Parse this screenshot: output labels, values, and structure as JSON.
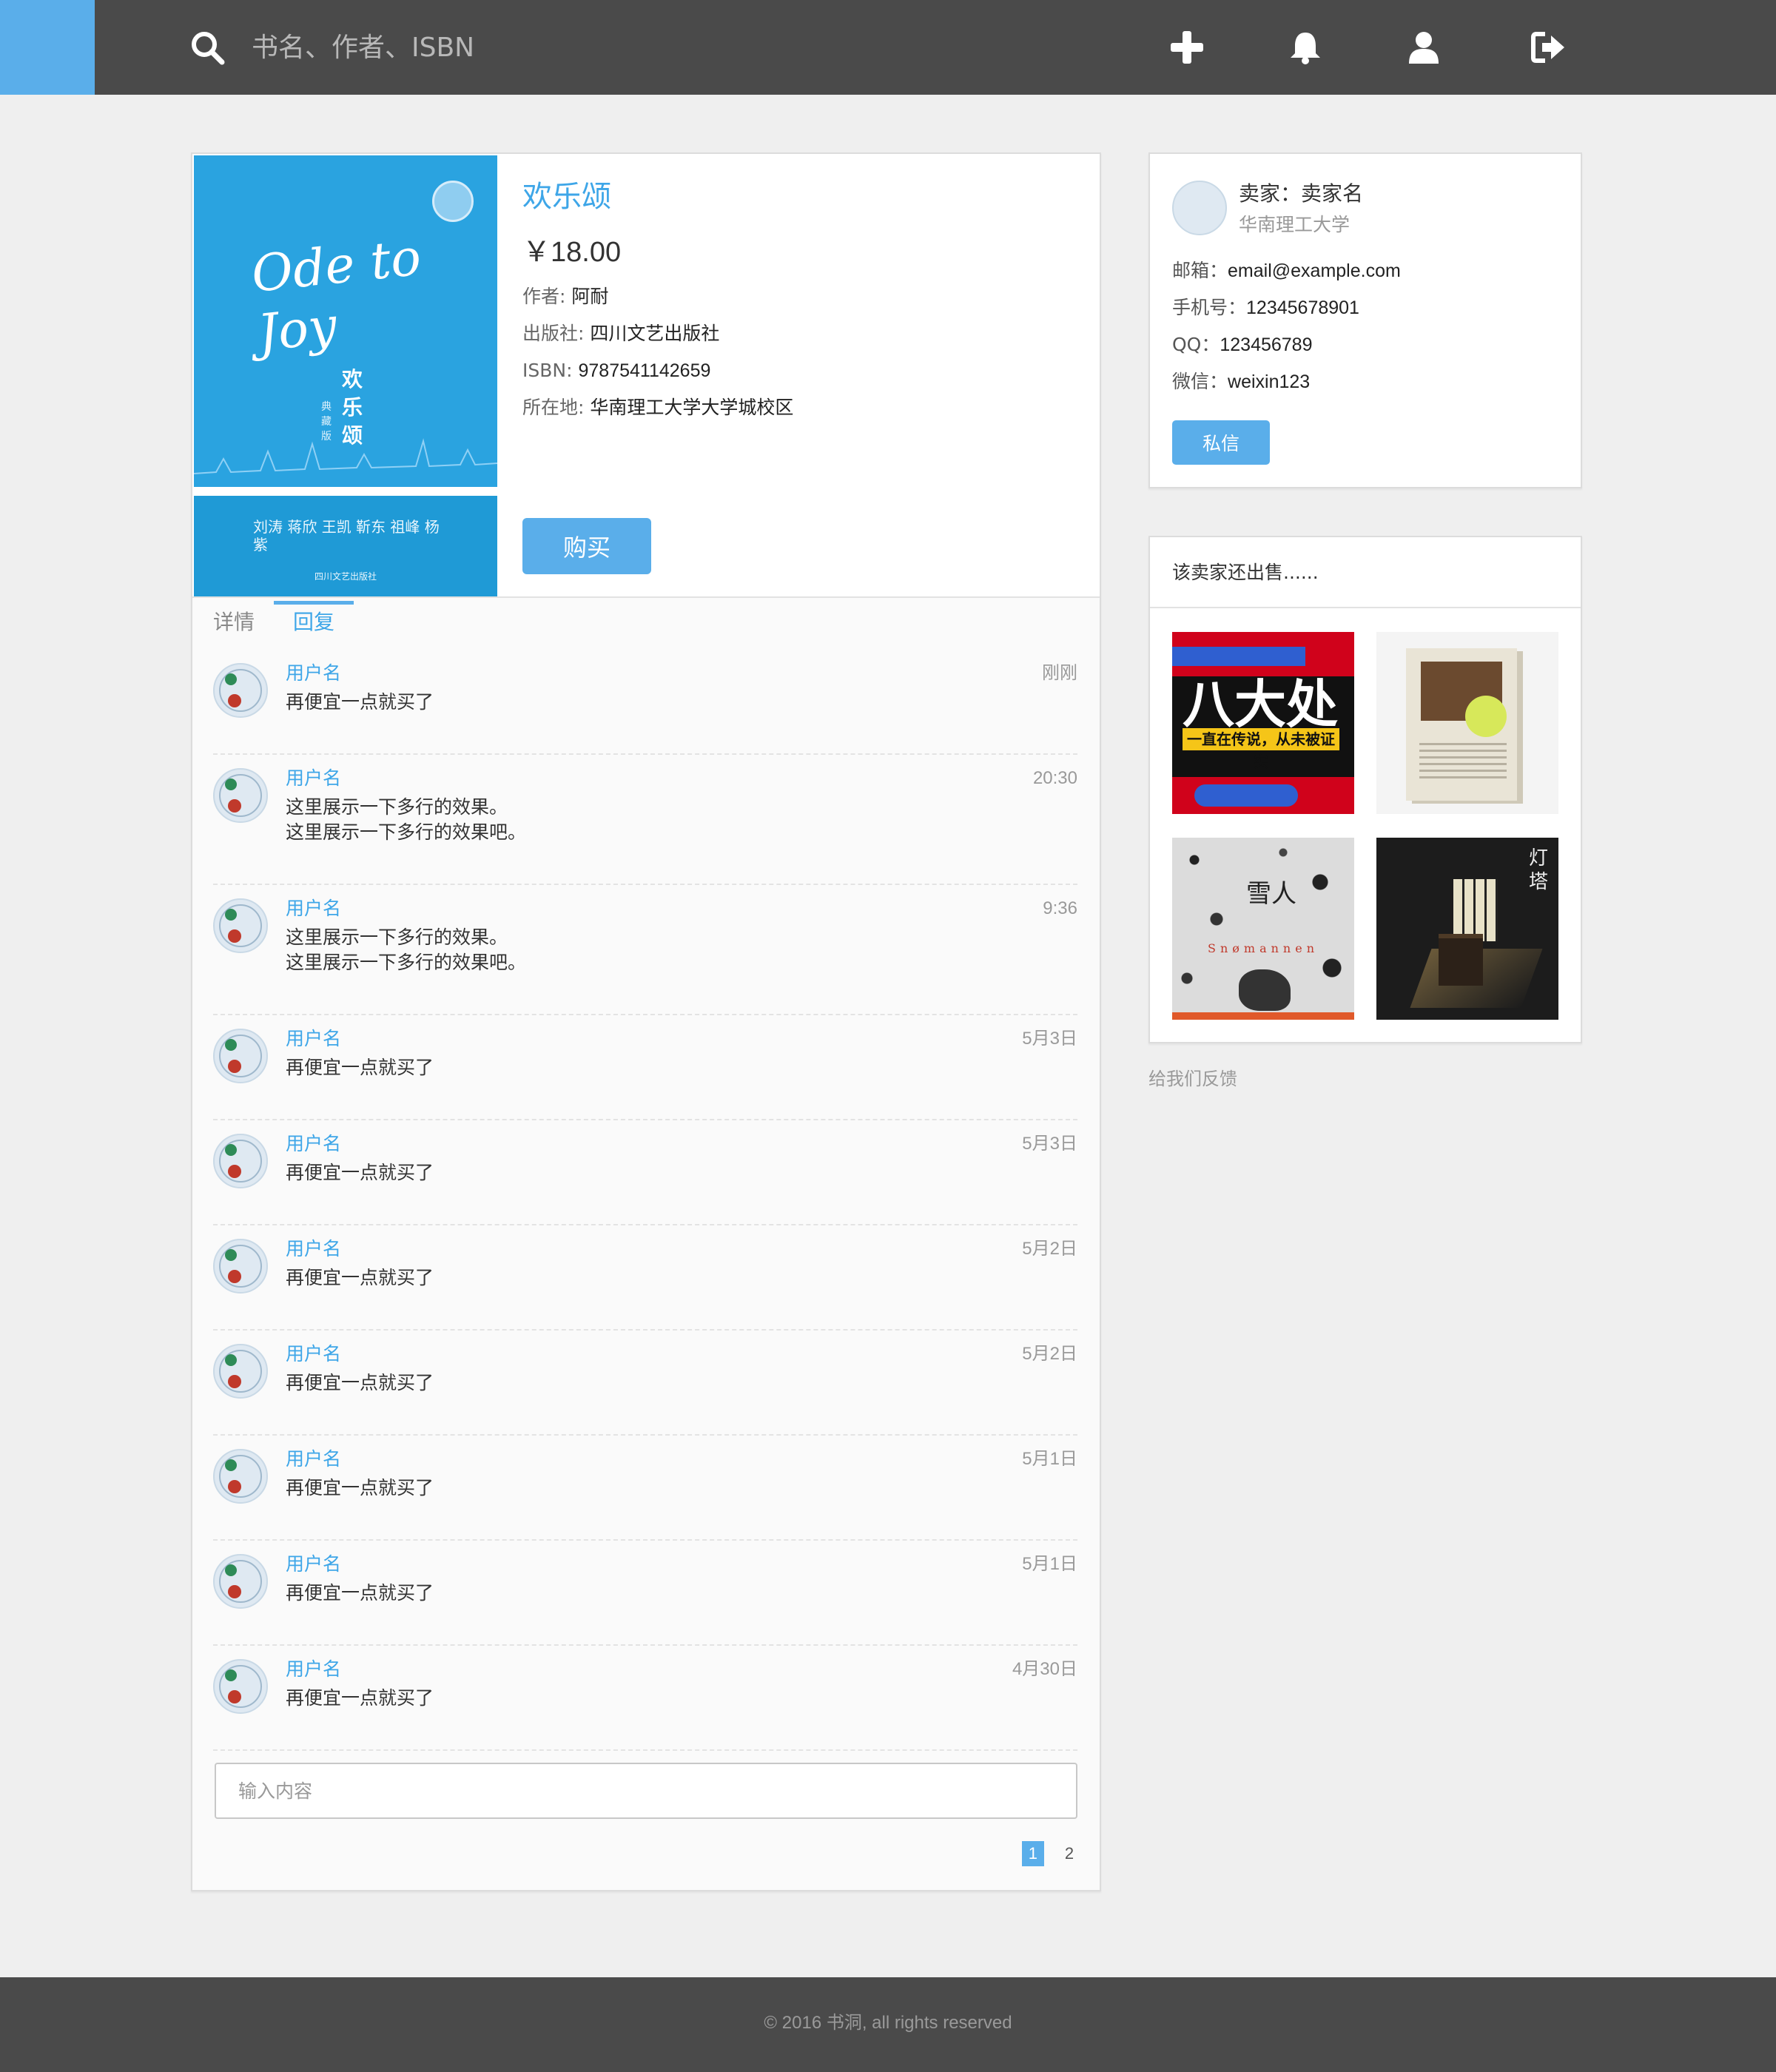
{
  "header": {
    "search_placeholder": "书名、作者、ISBN",
    "icons": [
      "search-icon",
      "plus-icon",
      "bell-icon",
      "user-icon",
      "logout-icon"
    ]
  },
  "book": {
    "title": "欢乐颂",
    "price": "￥18.00",
    "author_label": "作者:",
    "author": "阿耐",
    "publisher_label": "出版社:",
    "publisher": "四川文艺出版社",
    "isbn_label": "ISBN:",
    "isbn": "9787541142659",
    "location_label": "所在地:",
    "location": "华南理工大学大学城校区",
    "buy_label": "购买",
    "cover": {
      "ode_line1": "Ode to",
      "ode_line2": "Joy",
      "cn_title": "欢乐颂",
      "cn_sub": "典藏版",
      "names": "刘涛 蒋欣 王凯 靳东 祖峰 杨紫",
      "publisher_line": "四川文艺出版社"
    }
  },
  "tabs": {
    "detail": "详情",
    "reply": "回复",
    "active": "reply"
  },
  "comments": [
    {
      "user": "用户名",
      "time": "刚刚",
      "lines": [
        "再便宜一点就买了"
      ]
    },
    {
      "user": "用户名",
      "time": "20:30",
      "lines": [
        "这里展示一下多行的效果。",
        "这里展示一下多行的效果吧。"
      ]
    },
    {
      "user": "用户名",
      "time": "9:36",
      "lines": [
        "这里展示一下多行的效果。",
        "这里展示一下多行的效果吧。"
      ]
    },
    {
      "user": "用户名",
      "time": "5月3日",
      "lines": [
        "再便宜一点就买了"
      ]
    },
    {
      "user": "用户名",
      "time": "5月3日",
      "lines": [
        "再便宜一点就买了"
      ]
    },
    {
      "user": "用户名",
      "time": "5月2日",
      "lines": [
        "再便宜一点就买了"
      ]
    },
    {
      "user": "用户名",
      "time": "5月2日",
      "lines": [
        "再便宜一点就买了"
      ]
    },
    {
      "user": "用户名",
      "time": "5月1日",
      "lines": [
        "再便宜一点就买了"
      ]
    },
    {
      "user": "用户名",
      "time": "5月1日",
      "lines": [
        "再便宜一点就买了"
      ]
    },
    {
      "user": "用户名",
      "time": "4月30日",
      "lines": [
        "再便宜一点就买了"
      ]
    }
  ],
  "reply_input": {
    "placeholder": "输入内容",
    "value": ""
  },
  "pagination": {
    "pages": [
      "1",
      "2"
    ],
    "current": "1"
  },
  "seller": {
    "name": "卖家：卖家名",
    "school": "华南理工大学",
    "email_label": "邮箱：",
    "email": "email@example.com",
    "phone_label": "手机号：",
    "phone": "12345678901",
    "qq_label": "QQ：",
    "qq": "123456789",
    "wechat_label": "微信：",
    "wechat": "weixin123",
    "message_label": "私信"
  },
  "also_sells": {
    "title": "该卖家还出售......",
    "books": [
      {
        "cover_text": "八大处",
        "slogan": "一直在传说，从未被证实"
      },
      {
        "cover_text": ""
      },
      {
        "cover_text": "雪人",
        "subtitle": "Snømannen"
      },
      {
        "cover_text": "灯塔"
      }
    ]
  },
  "feedback_label": "给我们反馈",
  "footer": {
    "copyright": "© 2016 书洞, all rights reserved"
  },
  "colors": {
    "accent": "#5aaeea",
    "link": "#3ea6e8",
    "topbar": "#4a4a4a",
    "background": "#efefef"
  }
}
